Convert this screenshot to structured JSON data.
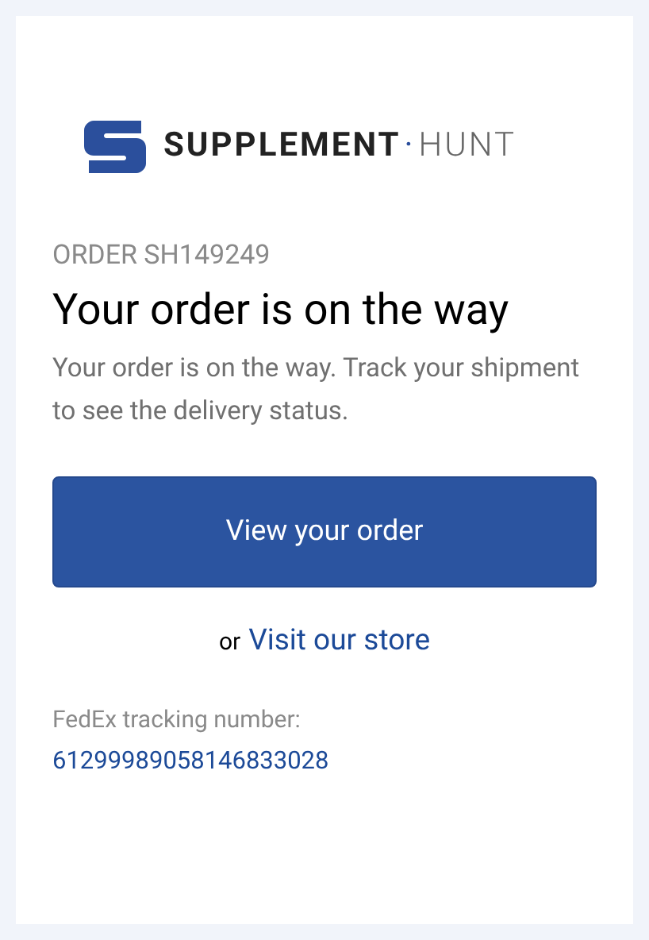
{
  "logo": {
    "brand_main": "SUPPLEMENT",
    "brand_dot": "·",
    "brand_sub": "HUNT"
  },
  "order_number": "ORDER SH149249",
  "heading": "Your order is on the way",
  "message": "Your order is on the way. Track your shipment to see the delivery status.",
  "primary_button": "View your order",
  "secondary": {
    "prefix": "or",
    "link": "Visit our store"
  },
  "tracking": {
    "label": "FedEx tracking number:",
    "number": "61299989058146833028"
  }
}
